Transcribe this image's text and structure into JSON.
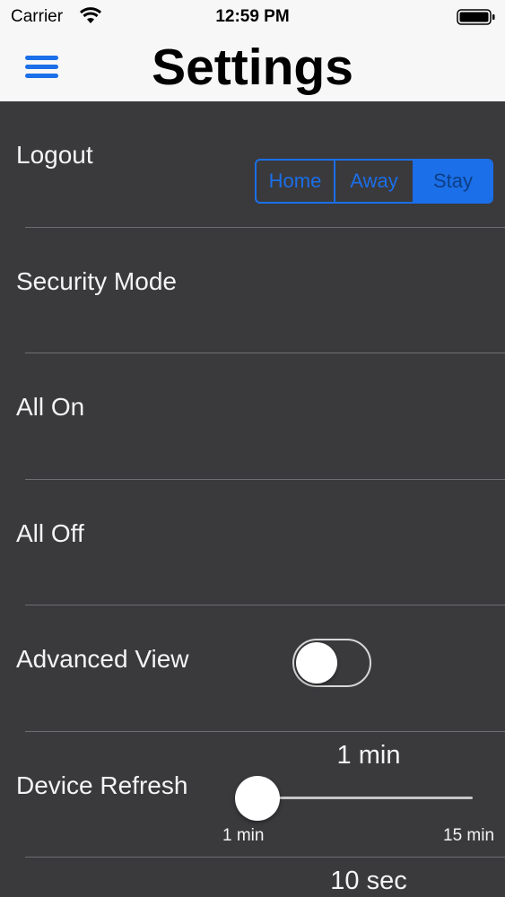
{
  "status_bar": {
    "carrier": "Carrier",
    "time": "12:59 PM"
  },
  "nav_bar": {
    "title": "Settings"
  },
  "rows": [
    {
      "label": "Logout"
    },
    {
      "label": "Security Mode"
    },
    {
      "label": "All On"
    },
    {
      "label": "All Off"
    },
    {
      "label": "Advanced View"
    },
    {
      "label": "Device Refresh"
    }
  ],
  "security_mode": {
    "options": [
      "Home",
      "Away",
      "Stay"
    ],
    "selected": "Stay"
  },
  "advanced_view": {
    "on": false
  },
  "device_refresh": {
    "value": "1 min",
    "min_label": "1 min",
    "max_label": "15 min",
    "level": 0
  },
  "next_value": "10 sec",
  "colors": {
    "accent": "#1b6fe8",
    "background": "#3a393c",
    "bar": "#f7f7f7"
  }
}
